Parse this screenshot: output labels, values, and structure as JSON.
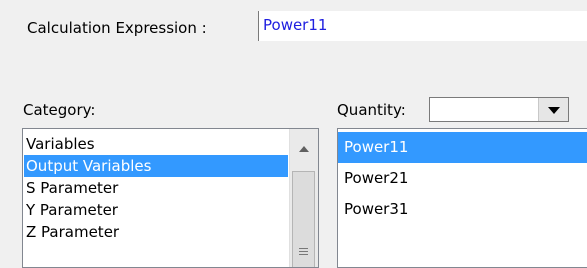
{
  "expression": {
    "label": "Calculation Expression :",
    "value": "Power11"
  },
  "category": {
    "label": "Category:",
    "items": [
      {
        "label": "Variables",
        "selected": false
      },
      {
        "label": "Output Variables",
        "selected": true
      },
      {
        "label": "S Parameter",
        "selected": false
      },
      {
        "label": "Y Parameter",
        "selected": false
      },
      {
        "label": "Z Parameter",
        "selected": false
      }
    ]
  },
  "quantity": {
    "label": "Quantity:",
    "selected_value": "",
    "items": [
      {
        "label": "Power11",
        "selected": true
      },
      {
        "label": "Power21",
        "selected": false
      },
      {
        "label": "Power31",
        "selected": false
      }
    ]
  },
  "colors": {
    "selection_bg": "#3399ff",
    "expression_text": "#2020e0"
  },
  "icons": [
    "scroll-up-arrow-icon",
    "scroll-grip-icon",
    "chevron-down-icon"
  ]
}
